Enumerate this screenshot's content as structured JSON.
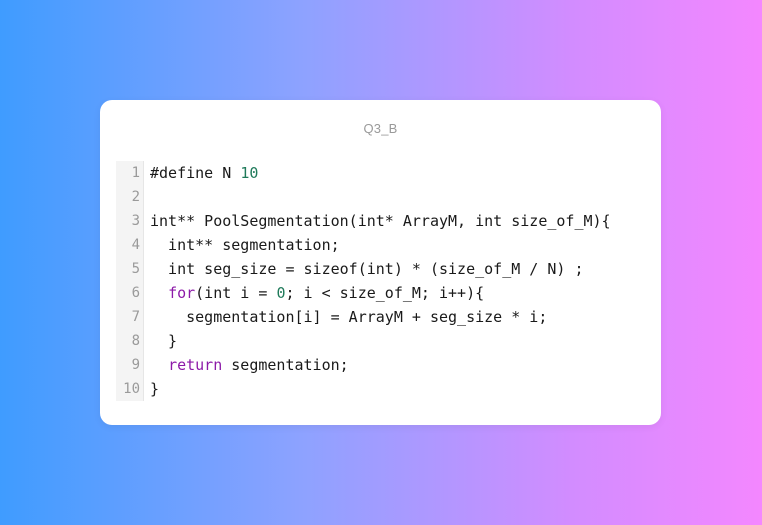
{
  "card": {
    "title": "Q3_B"
  },
  "colors": {
    "keyword": "#8c1aa8",
    "number": "#1f7a5a",
    "text": "#1a1a1a",
    "gutter_text": "#9a9a9a"
  },
  "code": {
    "lines": [
      {
        "number": "1",
        "tokens": [
          {
            "t": "plain",
            "v": "#define N "
          },
          {
            "t": "num",
            "v": "10"
          }
        ]
      },
      {
        "number": "2",
        "tokens": [
          {
            "t": "plain",
            "v": ""
          }
        ]
      },
      {
        "number": "3",
        "tokens": [
          {
            "t": "plain",
            "v": "int** PoolSegmentation(int* ArrayM, int size_of_M){"
          }
        ]
      },
      {
        "number": "4",
        "tokens": [
          {
            "t": "plain",
            "v": "  int** segmentation;"
          }
        ]
      },
      {
        "number": "5",
        "tokens": [
          {
            "t": "plain",
            "v": "  int seg_size = sizeof(int) * (size_of_M / N) ;"
          }
        ]
      },
      {
        "number": "6",
        "tokens": [
          {
            "t": "plain",
            "v": "  "
          },
          {
            "t": "kw",
            "v": "for"
          },
          {
            "t": "plain",
            "v": "(int i = "
          },
          {
            "t": "num",
            "v": "0"
          },
          {
            "t": "plain",
            "v": "; i < size_of_M; i++){"
          }
        ]
      },
      {
        "number": "7",
        "tokens": [
          {
            "t": "plain",
            "v": "    segmentation[i] = ArrayM + seg_size * i;"
          }
        ]
      },
      {
        "number": "8",
        "tokens": [
          {
            "t": "plain",
            "v": "  }"
          }
        ]
      },
      {
        "number": "9",
        "tokens": [
          {
            "t": "plain",
            "v": "  "
          },
          {
            "t": "kw",
            "v": "return"
          },
          {
            "t": "plain",
            "v": " segmentation;"
          }
        ]
      },
      {
        "number": "10",
        "tokens": [
          {
            "t": "plain",
            "v": "}"
          }
        ]
      }
    ]
  }
}
